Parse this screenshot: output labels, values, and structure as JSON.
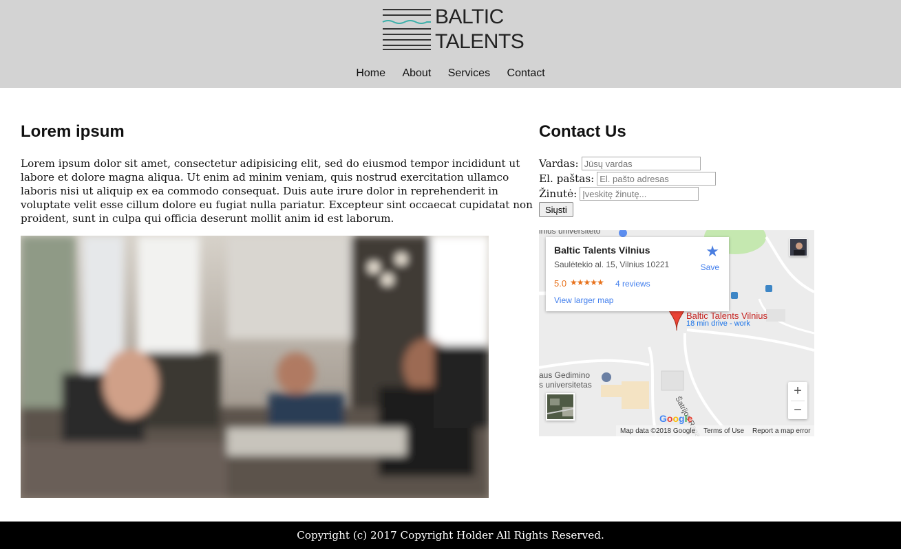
{
  "brand": {
    "line1": "BALTIC",
    "line2": "TALENTS",
    "logo_icon": "waves-logo-icon",
    "accent_color": "#3aafa9"
  },
  "nav": {
    "items": [
      "Home",
      "About",
      "Services",
      "Contact"
    ]
  },
  "main": {
    "heading": "Lorem ipsum",
    "paragraph": "Lorem ipsum dolor sit amet, consectetur adipisicing elit, sed do eiusmod tempor incididunt ut labore et dolore magna aliqua. Ut enim ad minim veniam, quis nostrud exercitation ullamco laboris nisi ut aliquip ex ea commodo consequat. Duis aute irure dolor in reprehenderit in voluptate velit esse cillum dolore eu fugiat nulla pariatur. Excepteur sint occaecat cupidatat non proident, sunt in culpa qui officia deserunt mollit anim id est laborum."
  },
  "contact": {
    "heading": "Contact Us",
    "name_label": "Vardas:",
    "name_placeholder": "Jūsų vardas",
    "email_label": "El. paštas:",
    "email_placeholder": "El. pašto adresas",
    "message_label": "Žinutė:",
    "message_placeholder": "Įveskitę žinutę...",
    "submit_label": "Siųsti"
  },
  "map": {
    "place_title": "Baltic Talents Vilnius",
    "address": "Saulėtekio al. 15, Vilnius 10221",
    "rating": "5.0",
    "stars": "★★★★★",
    "reviews": "4 reviews",
    "larger_map": "View larger map",
    "save": "Save",
    "pin_label": "Baltic Talents Vilnius",
    "pin_sub": "18 min drive - work",
    "label_top": "lnius universiteto",
    "label_mid1": "aus Gedimino",
    "label_mid2": "s universitetas",
    "street": "Šatrijos Raganos g.",
    "google": "Google",
    "map_data": "Map data ©2018 Google",
    "terms": "Terms of Use",
    "report": "Report a map error",
    "zoom_in": "+",
    "zoom_out": "−"
  },
  "footer": {
    "text": "Copyright (c) 2017 Copyright Holder All Rights Reserved."
  }
}
